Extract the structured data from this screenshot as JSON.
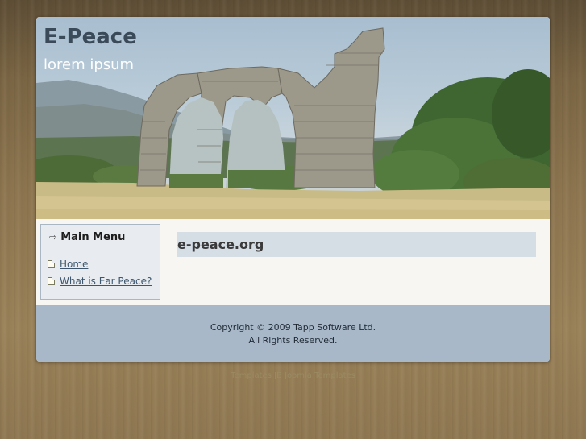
{
  "header": {
    "site_title": "E-Peace",
    "slogan": "lorem ipsum",
    "banner_image": "roman-aqueduct-ruins-landscape"
  },
  "sidebar": {
    "menu_title": "Main Menu",
    "menu_title_icon": "arrow-right-icon",
    "items": [
      {
        "label": "Home",
        "icon": "document-icon"
      },
      {
        "label": "What is Ear Peace?",
        "icon": "document-icon"
      }
    ]
  },
  "main": {
    "article_title": "e-peace.org"
  },
  "footer": {
    "copyright": "Copyright © 2009 Tapp Software Ltd.",
    "rights": "All Rights Reserved."
  },
  "credit": {
    "prefix": "Templates",
    "link": "JB Joomla Templates"
  },
  "colors": {
    "background_wood": "#8e7650",
    "page_bg": "#f7f6f2",
    "footer_bg": "#a8b8c8",
    "title_bar_bg": "#d5dde5",
    "menu_box_bg": "#e8ecf0",
    "link": "#3d566e",
    "site_title": "#3b4a58"
  }
}
